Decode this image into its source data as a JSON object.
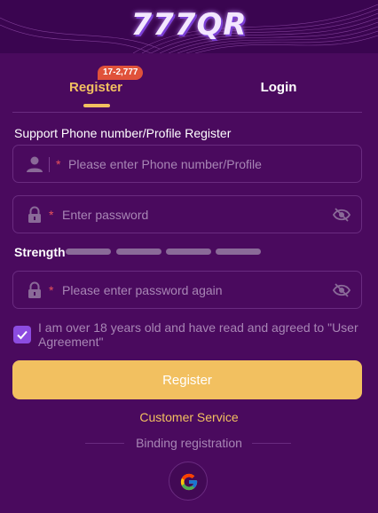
{
  "header": {
    "logo_text": "777QR"
  },
  "tabs": [
    {
      "label": "Register",
      "active": true,
      "badge": "17-2,777"
    },
    {
      "label": "Login",
      "active": false
    }
  ],
  "form": {
    "section_title": "Support Phone number/Profile Register",
    "required_mark": "*",
    "phone": {
      "placeholder": "Please enter Phone number/Profile",
      "icon": "user-icon"
    },
    "password": {
      "placeholder": "Enter password",
      "icon": "lock-icon",
      "toggle_icon": "eye-off-icon"
    },
    "strength": {
      "label": "Strength",
      "segments": 4,
      "filled": 0
    },
    "confirm": {
      "placeholder": "Please enter password again",
      "icon": "lock-icon",
      "toggle_icon": "eye-off-icon"
    },
    "agreement": {
      "checked": true,
      "text": "I am over 18 years old and have read and agreed to \"User Agreement\""
    },
    "submit_label": "Register"
  },
  "footer": {
    "customer_service": "Customer Service",
    "binding_label": "Binding registration",
    "social": [
      "google-icon"
    ]
  },
  "colors": {
    "background": "#4a0a5e",
    "accent": "#f2c060",
    "checkbox": "#8c4ce0",
    "badge": "#e0523a",
    "required": "#e8525a"
  }
}
